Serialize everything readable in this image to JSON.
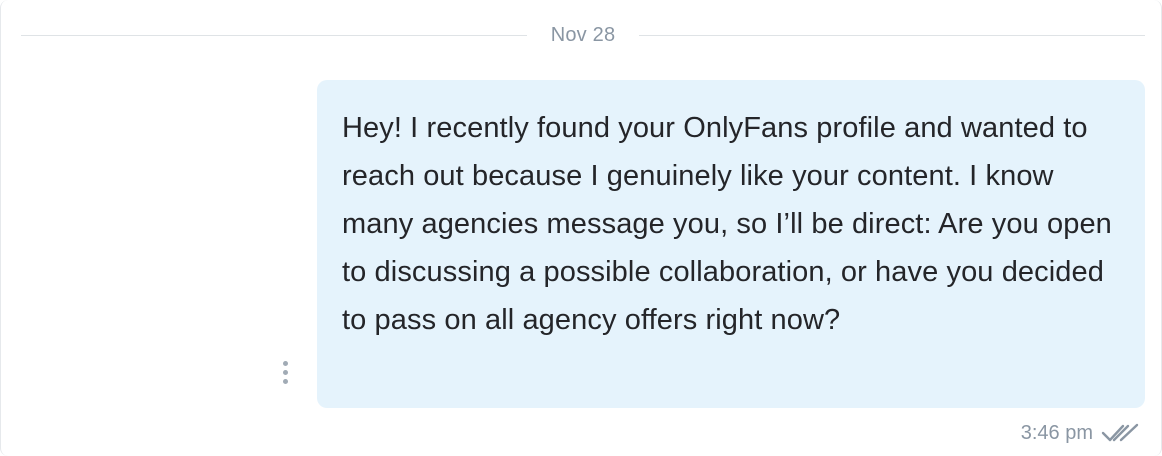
{
  "conversation": {
    "date_divider": "Nov 28",
    "message": {
      "text": "Hey! I recently found your OnlyFans profile and wanted to reach out because I genuinely like your content. I know many agencies message you, so I’ll be direct: Are you open to discussing a possible collaboration, or have you decided to pass on all agency offers right now?",
      "time": "3:46 pm",
      "status_icon": "double-check-icon"
    }
  },
  "colors": {
    "bubble_background": "#e5f3fc",
    "text": "#242529",
    "meta_text": "#8a96a3",
    "divider": "#dfe3e6"
  }
}
